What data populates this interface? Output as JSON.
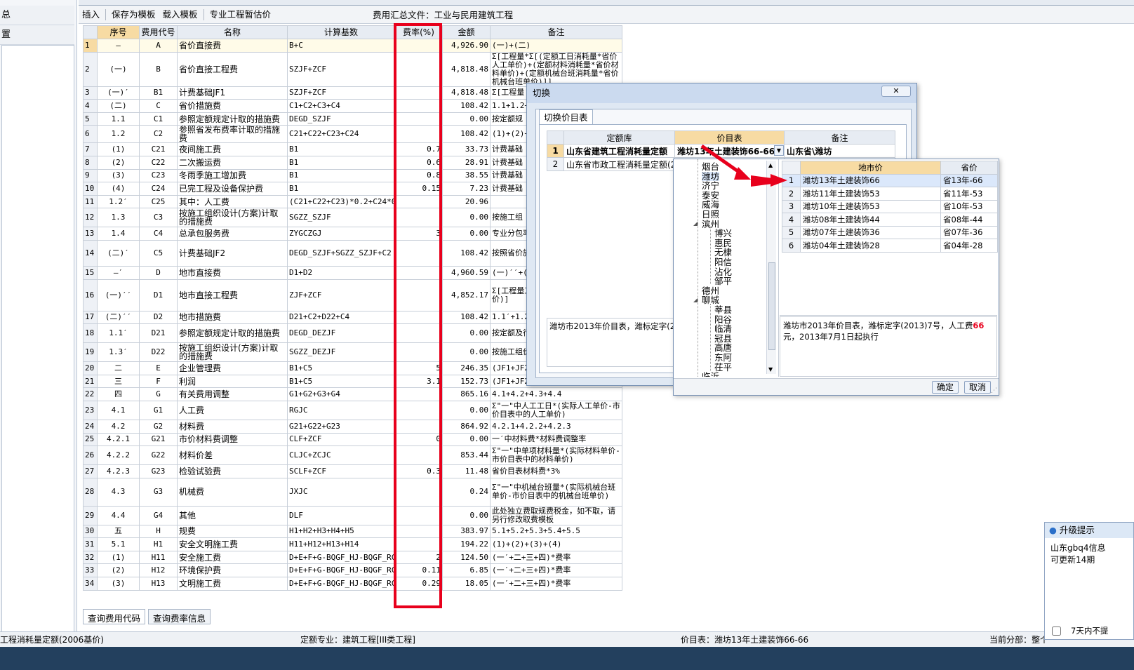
{
  "left_panel": {
    "items": [
      "总",
      "置"
    ]
  },
  "toolbar": {
    "insert": "插入",
    "save_template": "保存为模板",
    "load_template": "载入模板",
    "provisional": "专业工程暂估价",
    "summary_file_label": "费用汇总文件：工业与民用建筑工程"
  },
  "grid": {
    "headers": [
      "序号",
      "费用代号",
      "名称",
      "计算基数",
      "费率(%)",
      "金额",
      "备注"
    ],
    "rows": [
      {
        "n": "1",
        "seq": "—",
        "code": "A",
        "name": "省价直接费",
        "base": "B+C",
        "rate": "",
        "amount": "4,926.90",
        "note": "(一)+(二)"
      },
      {
        "n": "2",
        "seq": "(一)",
        "code": "B",
        "name": "省价直接工程费",
        "base": "SZJF+ZCF",
        "rate": "",
        "amount": "4,818.48",
        "note": "Σ[工程量*Σ[(定额工日消耗量*省价人工单价)+(定额材料消耗量*省价材料单价)+(定额机械台班消耗量*省价机械台班单价)]]"
      },
      {
        "n": "3",
        "seq": "(一)′",
        "code": "B1",
        "name": "计费基础JF1",
        "base": "SZJF+ZCF",
        "rate": "",
        "amount": "4,818.48",
        "note": "Σ[工程量"
      },
      {
        "n": "4",
        "seq": "(二)",
        "code": "C",
        "name": "省价措施费",
        "base": "C1+C2+C3+C4",
        "rate": "",
        "amount": "108.42",
        "note": "1.1+1.2+"
      },
      {
        "n": "5",
        "seq": "1.1",
        "code": "C1",
        "name": "参照定额规定计取的措施费",
        "base": "DEGD_SZJF",
        "rate": "",
        "amount": "0.00",
        "note": "按定额规"
      },
      {
        "n": "6",
        "seq": "1.2",
        "code": "C2",
        "name": "参照省发布费率计取的措施费",
        "base": "C21+C22+C23+C24",
        "rate": "",
        "amount": "108.42",
        "note": "(1)+(2)+"
      },
      {
        "n": "7",
        "seq": "(1)",
        "code": "C21",
        "name": "夜间施工费",
        "base": "B1",
        "rate": "0.7",
        "amount": "33.73",
        "note": "计费基础"
      },
      {
        "n": "8",
        "seq": "(2)",
        "code": "C22",
        "name": "二次搬运费",
        "base": "B1",
        "rate": "0.6",
        "amount": "28.91",
        "note": "计费基础"
      },
      {
        "n": "9",
        "seq": "(3)",
        "code": "C23",
        "name": "冬雨季施工增加费",
        "base": "B1",
        "rate": "0.8",
        "amount": "38.55",
        "note": "计费基础"
      },
      {
        "n": "10",
        "seq": "(4)",
        "code": "C24",
        "name": "已完工程及设备保护费",
        "base": "B1",
        "rate": "0.15",
        "amount": "7.23",
        "note": "计费基础"
      },
      {
        "n": "11",
        "seq": "1.2′",
        "code": "C25",
        "name": "其中：人工费",
        "base": "(C21+C22+C23)*0.2+C24*0.1",
        "rate": "",
        "amount": "20.96",
        "note": ""
      },
      {
        "n": "12",
        "seq": "1.3",
        "code": "C3",
        "name": "按施工组织设计(方案)计取的措施费",
        "base": "SGZZ_SZJF",
        "rate": "",
        "amount": "0.00",
        "note": "按施工组"
      },
      {
        "n": "13",
        "seq": "1.4",
        "code": "C4",
        "name": "总承包服务费",
        "base": "ZYGCZGJ",
        "rate": "3",
        "amount": "0.00",
        "note": "专业分包率"
      },
      {
        "n": "14",
        "seq": "(二)′",
        "code": "C5",
        "name": "计费基础JF2",
        "base": "DEGD_SZJF+SGZZ_SZJF+C2",
        "rate": "",
        "amount": "108.42",
        "note": "按照省价施费与按的措施费"
      },
      {
        "n": "15",
        "seq": "—′",
        "code": "D",
        "name": "地市直接费",
        "base": "D1+D2",
        "rate": "",
        "amount": "4,960.59",
        "note": "(一)′′+("
      },
      {
        "n": "16",
        "seq": "(一)′′",
        "code": "D1",
        "name": "地市直接工程费",
        "base": "ZJF+ZCF",
        "rate": "",
        "amount": "4,852.17",
        "note": "Σ[工程量工单价)+价)+(定额班单价)]"
      },
      {
        "n": "17",
        "seq": "(二)′′",
        "code": "D2",
        "name": "地市措施费",
        "base": "D21+C2+D22+C4",
        "rate": "",
        "amount": "108.42",
        "note": "1.1′+1.2"
      },
      {
        "n": "18",
        "seq": "1.1′",
        "code": "D21",
        "name": "参照定额规定计取的措施费",
        "base": "DEGD_DEZJF",
        "rate": "",
        "amount": "0.00",
        "note": "按定额及行市价目"
      },
      {
        "n": "19",
        "seq": "1.3′",
        "code": "D22",
        "name": "按施工组织设计(方案)计取的措施费",
        "base": "SGZZ_DEZJF",
        "rate": "",
        "amount": "0.00",
        "note": "按施工组价执行市"
      },
      {
        "n": "20",
        "seq": "二",
        "code": "E",
        "name": "企业管理费",
        "base": "B1+C5",
        "rate": "5",
        "amount": "246.35",
        "note": "(JF1+JF2"
      },
      {
        "n": "21",
        "seq": "三",
        "code": "F",
        "name": "利润",
        "base": "B1+C5",
        "rate": "3.1",
        "amount": "152.73",
        "note": "(JF1+JF2)*利润率"
      },
      {
        "n": "22",
        "seq": "四",
        "code": "G",
        "name": "有关费用调整",
        "base": "G1+G2+G3+G4",
        "rate": "",
        "amount": "865.16",
        "note": "4.1+4.2+4.3+4.4"
      },
      {
        "n": "23",
        "seq": "4.1",
        "code": "G1",
        "name": "人工费",
        "base": "RGJC",
        "rate": "",
        "amount": "0.00",
        "note": "Σ\"一\"中人工工日*(实际人工单价-市价目表中的人工单价)"
      },
      {
        "n": "24",
        "seq": "4.2",
        "code": "G2",
        "name": "材料费",
        "base": "G21+G22+G23",
        "rate": "",
        "amount": "864.92",
        "note": "4.2.1+4.2.2+4.2.3"
      },
      {
        "n": "25",
        "seq": "4.2.1",
        "code": "G21",
        "name": "市价材料费调整",
        "base": "CLF+ZCF",
        "rate": "0",
        "amount": "0.00",
        "note": "一′中材料费*材料费调整率"
      },
      {
        "n": "26",
        "seq": "4.2.2",
        "code": "G22",
        "name": "材料价差",
        "base": "CLJC+ZCJC",
        "rate": "",
        "amount": "853.44",
        "note": "Σ\"一\"中单项材料量*(实际材料单价-市价目表中的材料单价)"
      },
      {
        "n": "27",
        "seq": "4.2.3",
        "code": "G23",
        "name": "检验试验费",
        "base": "SCLF+ZCF",
        "rate": "0.3",
        "amount": "11.48",
        "note": "省价目表材料费*3%"
      },
      {
        "n": "28",
        "seq": "4.3",
        "code": "G3",
        "name": "机械费",
        "base": "JXJC",
        "rate": "",
        "amount": "0.24",
        "note": "Σ\"一\"中机械台班量*(实际机械台班单价-市价目表中的机械台班单价)"
      },
      {
        "n": "29",
        "seq": "4.4",
        "code": "G4",
        "name": "其他",
        "base": "DLF",
        "rate": "",
        "amount": "0.00",
        "note": "此处独立费取规费税金，如不取，请另行修改取费模板"
      },
      {
        "n": "30",
        "seq": "五",
        "code": "H",
        "name": "规费",
        "base": "H1+H2+H3+H4+H5",
        "rate": "",
        "amount": "383.97",
        "note": "5.1+5.2+5.3+5.4+5.5"
      },
      {
        "n": "31",
        "seq": "5.1",
        "code": "H1",
        "name": "安全文明施工费",
        "base": "H11+H12+H13+H14",
        "rate": "",
        "amount": "194.22",
        "note": "(1)+(2)+(3)+(4)"
      },
      {
        "n": "32",
        "seq": "(1)",
        "code": "H11",
        "name": "安全施工费",
        "base": "D+E+F+G-BQGF_HJ-BQGF_RCJJ",
        "rate": "2",
        "amount": "124.50",
        "note": "(一′+二+三+四)*费率"
      },
      {
        "n": "33",
        "seq": "(2)",
        "code": "H12",
        "name": "环境保护费",
        "base": "D+E+F+G-BQGF_HJ-BQGF_RCJJ",
        "rate": "0.11",
        "amount": "6.85",
        "note": "(一′+二+三+四)*费率"
      },
      {
        "n": "34",
        "seq": "(3)",
        "code": "H13",
        "name": "文明施工费",
        "base": "D+E+F+G-BQGF_HJ-BQGF_RCJJ",
        "rate": "0.29",
        "amount": "18.05",
        "note": "(一′+二+三+四)*费率"
      }
    ]
  },
  "bottom_tabs": [
    "查询费用代码",
    "查询费率信息"
  ],
  "status": {
    "left": "工程消耗量定额(2006基价)",
    "specialty": "定额专业：建筑工程[III类工程]",
    "price_table": "价目表：潍坊13年土建装饰66-66",
    "current_part": "当前分部：整个"
  },
  "dialog": {
    "title": "切换",
    "tab": "切换价目表",
    "headers": [
      "定额库",
      "价目表",
      "备注"
    ],
    "rows": [
      {
        "n": "1",
        "lib": "山东省建筑工程消耗量定额",
        "price": "潍坊13年土建装饰66-66",
        "note": "山东省\\潍坊"
      },
      {
        "n": "2",
        "lib": "山东省市政工程消耗量定额(2",
        "price": "",
        "note": ""
      }
    ],
    "desc": "潍坊市2013年价目表，潍标定字(2013"
  },
  "popup": {
    "tree": [
      "烟台",
      "潍坊",
      "济宁",
      "泰安",
      "威海",
      "日照",
      "滨州",
      "博兴",
      "惠民",
      "无棣",
      "阳信",
      "沾化",
      "邹平",
      "德州",
      "聊城",
      "莘县",
      "阳谷",
      "临清",
      "冠县",
      "高唐",
      "东阿",
      "茌平",
      "临沂"
    ],
    "headers": [
      "地市价",
      "省价"
    ],
    "rows": [
      {
        "n": "1",
        "city": "潍坊13年土建装饰66",
        "prov": "省13年-66"
      },
      {
        "n": "2",
        "city": "潍坊11年土建装饰53",
        "prov": "省11年-53"
      },
      {
        "n": "3",
        "city": "潍坊10年土建装饰53",
        "prov": "省10年-53"
      },
      {
        "n": "4",
        "city": "潍坊08年土建装饰44",
        "prov": "省08年-44"
      },
      {
        "n": "5",
        "city": "潍坊07年土建装饰36",
        "prov": "省07年-36"
      },
      {
        "n": "6",
        "city": "潍坊04年土建装饰28",
        "prov": "省04年-28"
      }
    ],
    "desc_pre": "潍坊市2013年价目表，潍标定字(2013)7号，人工费",
    "desc_red": "66",
    "desc_post": "元，2013年7月1日起执行",
    "ok": "确定",
    "cancel": "取消"
  },
  "upgrade": {
    "title": "升级提示",
    "line1": "山东gbq4信息",
    "line2": "可更新14期",
    "checkbox_label": "7天内不提"
  },
  "colors": {
    "highlight_red": "#e8001c",
    "header_orange": "#f7dba3",
    "selection_blue": "#dbe8fb"
  }
}
